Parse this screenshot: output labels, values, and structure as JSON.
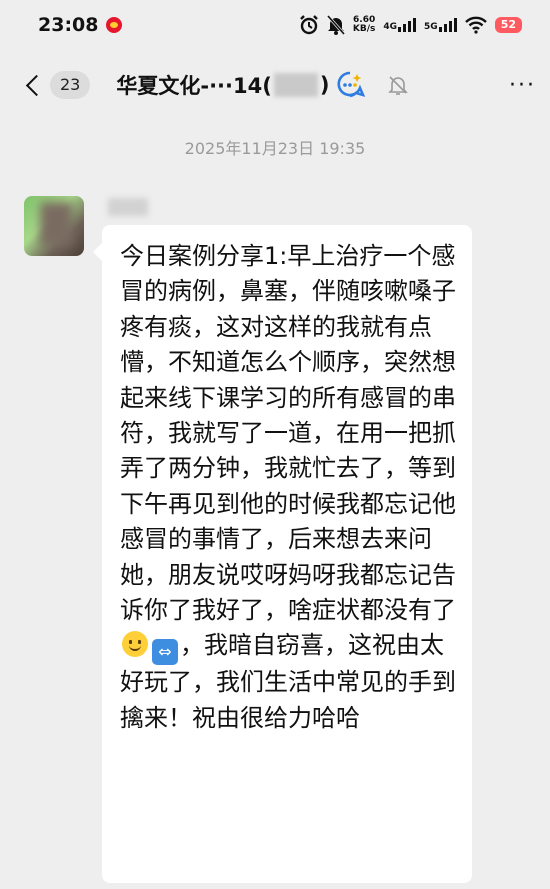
{
  "status_bar": {
    "time": "23:08",
    "net_speed": "6.60",
    "net_unit": "KB/s",
    "sim1": "4G",
    "sim2": "5G",
    "battery": "52"
  },
  "header": {
    "unread_count": "23",
    "chat_title_left": "华夏文化-···14(",
    "chat_title_right": ")",
    "more_label": "···"
  },
  "chat": {
    "timestamp": "2025年11月23日 19:35",
    "message_part1": "今日案例分享1:早上治疗一个感冒的病例，鼻塞，伴随咳嗽嗓子疼有痰，这对这样的我就有点懵，不知道怎么个顺序，突然想起来线下课学习的所有感冒的串符，我就写了一道，在用一把抓弄了两分钟，我就忙去了，等到下午再见到他的时候我都忘记他感冒的事情了，后来想去来问她，朋友说哎呀妈呀我都忘记告诉你了我好了，啥症状都没有了",
    "message_part2": "，我暗自窃喜，这祝由太好玩了，我们生活中常见的手到擒来！祝由很给力哈哈",
    "emoji_arrow_glyph": "⇔"
  },
  "colors": {
    "background": "#eeeeee",
    "bubble": "#ffffff",
    "timestamp": "#9a9a9a",
    "battery": "#ff5a5f"
  }
}
